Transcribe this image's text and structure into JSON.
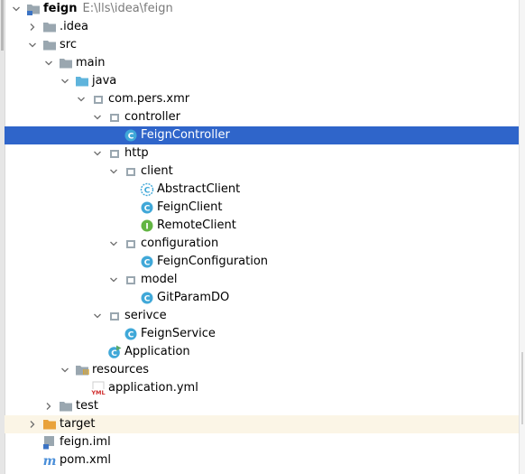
{
  "tree": {
    "root": {
      "label": "feign",
      "path": "E:\\lls\\idea\\feign"
    },
    "idea": {
      "label": ".idea"
    },
    "src": {
      "label": "src"
    },
    "main": {
      "label": "main"
    },
    "java": {
      "label": "java"
    },
    "com_pers_xmr": {
      "label": "com.pers.xmr"
    },
    "controller": {
      "label": "controller"
    },
    "feign_controller": {
      "label": "FeignController"
    },
    "http": {
      "label": "http"
    },
    "client": {
      "label": "client"
    },
    "abstract_client": {
      "label": "AbstractClient"
    },
    "feign_client": {
      "label": "FeignClient"
    },
    "remote_client": {
      "label": "RemoteClient"
    },
    "configuration": {
      "label": "configuration"
    },
    "feign_configuration": {
      "label": "FeignConfiguration"
    },
    "model": {
      "label": "model"
    },
    "git_param_do": {
      "label": "GitParamDO"
    },
    "serivce": {
      "label": "serivce"
    },
    "feign_service": {
      "label": "FeignService"
    },
    "application": {
      "label": "Application"
    },
    "resources": {
      "label": "resources"
    },
    "application_yml": {
      "label": "application.yml",
      "badge": "YML"
    },
    "test": {
      "label": "test"
    },
    "target": {
      "label": "target"
    },
    "feign_iml": {
      "label": "feign.iml"
    },
    "pom_xml": {
      "label": "pom.xml",
      "badge": "m"
    }
  },
  "icon_legend": {
    "class": "C",
    "interface": "I"
  },
  "colors": {
    "selection": "#2f65ca",
    "target_highlight": "#fbf5e6",
    "folder": "#9aa7b0",
    "source_folder": "#5fb4dc",
    "target_folder": "#e9a23a",
    "class_icon": "#40a8d8",
    "interface_icon": "#62b543"
  }
}
